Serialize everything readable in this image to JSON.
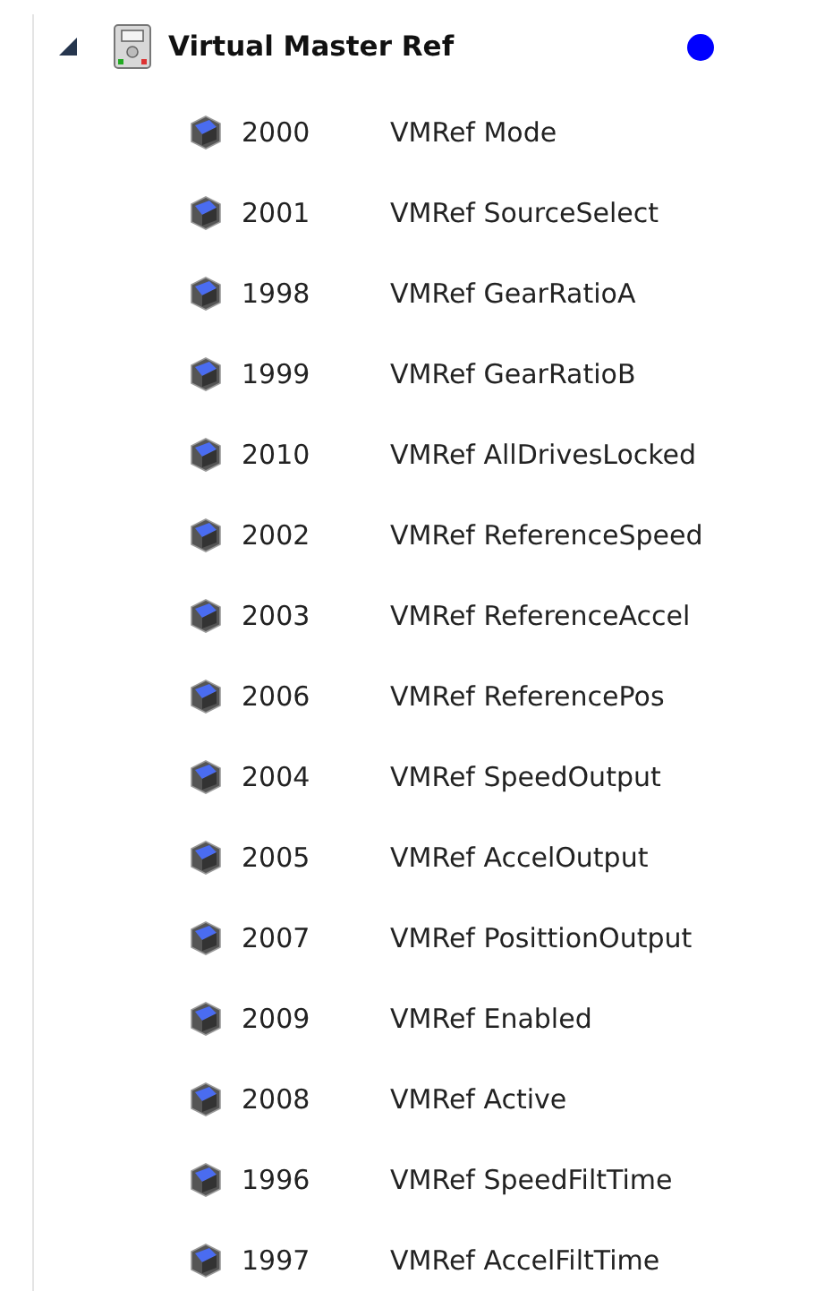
{
  "tree": {
    "label": "Virtual Master Ref",
    "expanded": true,
    "color": "#0000ff",
    "children": [
      {
        "number": "2000",
        "name": "VMRef Mode"
      },
      {
        "number": "2001",
        "name": "VMRef SourceSelect"
      },
      {
        "number": "1998",
        "name": "VMRef GearRatioA"
      },
      {
        "number": "1999",
        "name": "VMRef GearRatioB"
      },
      {
        "number": "2010",
        "name": "VMRef AllDrivesLocked"
      },
      {
        "number": "2002",
        "name": "VMRef ReferenceSpeed"
      },
      {
        "number": "2003",
        "name": "VMRef ReferenceAccel"
      },
      {
        "number": "2006",
        "name": "VMRef ReferencePos"
      },
      {
        "number": "2004",
        "name": "VMRef SpeedOutput"
      },
      {
        "number": "2005",
        "name": "VMRef AccelOutput"
      },
      {
        "number": "2007",
        "name": "VMRef PosittionOutput"
      },
      {
        "number": "2009",
        "name": "VMRef Enabled"
      },
      {
        "number": "2008",
        "name": "VMRef Active"
      },
      {
        "number": "1996",
        "name": "VMRef SpeedFiltTime"
      },
      {
        "number": "1997",
        "name": "VMRef AccelFiltTime"
      }
    ]
  }
}
